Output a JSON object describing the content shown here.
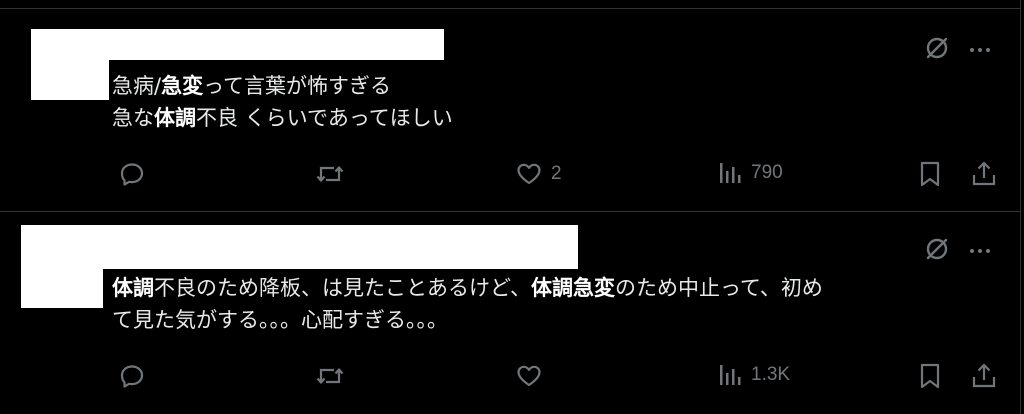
{
  "posts": [
    {
      "lines": [
        [
          {
            "t": "急病/",
            "b": false
          },
          {
            "t": "急変",
            "b": true
          },
          {
            "t": "って言葉が怖すぎる",
            "b": false
          }
        ],
        [
          {
            "t": "急な",
            "b": false
          },
          {
            "t": "体調",
            "b": true
          },
          {
            "t": "不良 くらいであってほしい",
            "b": false
          }
        ]
      ],
      "likes": "2",
      "views": "790"
    },
    {
      "lines": [
        [
          {
            "t": "体調",
            "b": true
          },
          {
            "t": "不良のため降板、は見たことあるけど、",
            "b": false
          },
          {
            "t": "体調急変",
            "b": true
          },
          {
            "t": "のため中止って、初め",
            "b": false
          }
        ],
        [
          {
            "t": "て見た気がする。。。心配すぎる。。。",
            "b": false
          }
        ]
      ],
      "likes": "",
      "views": "1.3K"
    }
  ],
  "icons": {
    "grok": "no-entry-icon",
    "more": "more-icon",
    "reply": "reply-icon",
    "retweet": "repost-icon",
    "like": "heart-icon",
    "views": "views-icon",
    "bookmark": "bookmark-icon",
    "share": "share-icon"
  },
  "colors": {
    "background": "#000000",
    "text": "#e7e9ea",
    "muted": "#71767b",
    "divider": "#2f3336"
  }
}
